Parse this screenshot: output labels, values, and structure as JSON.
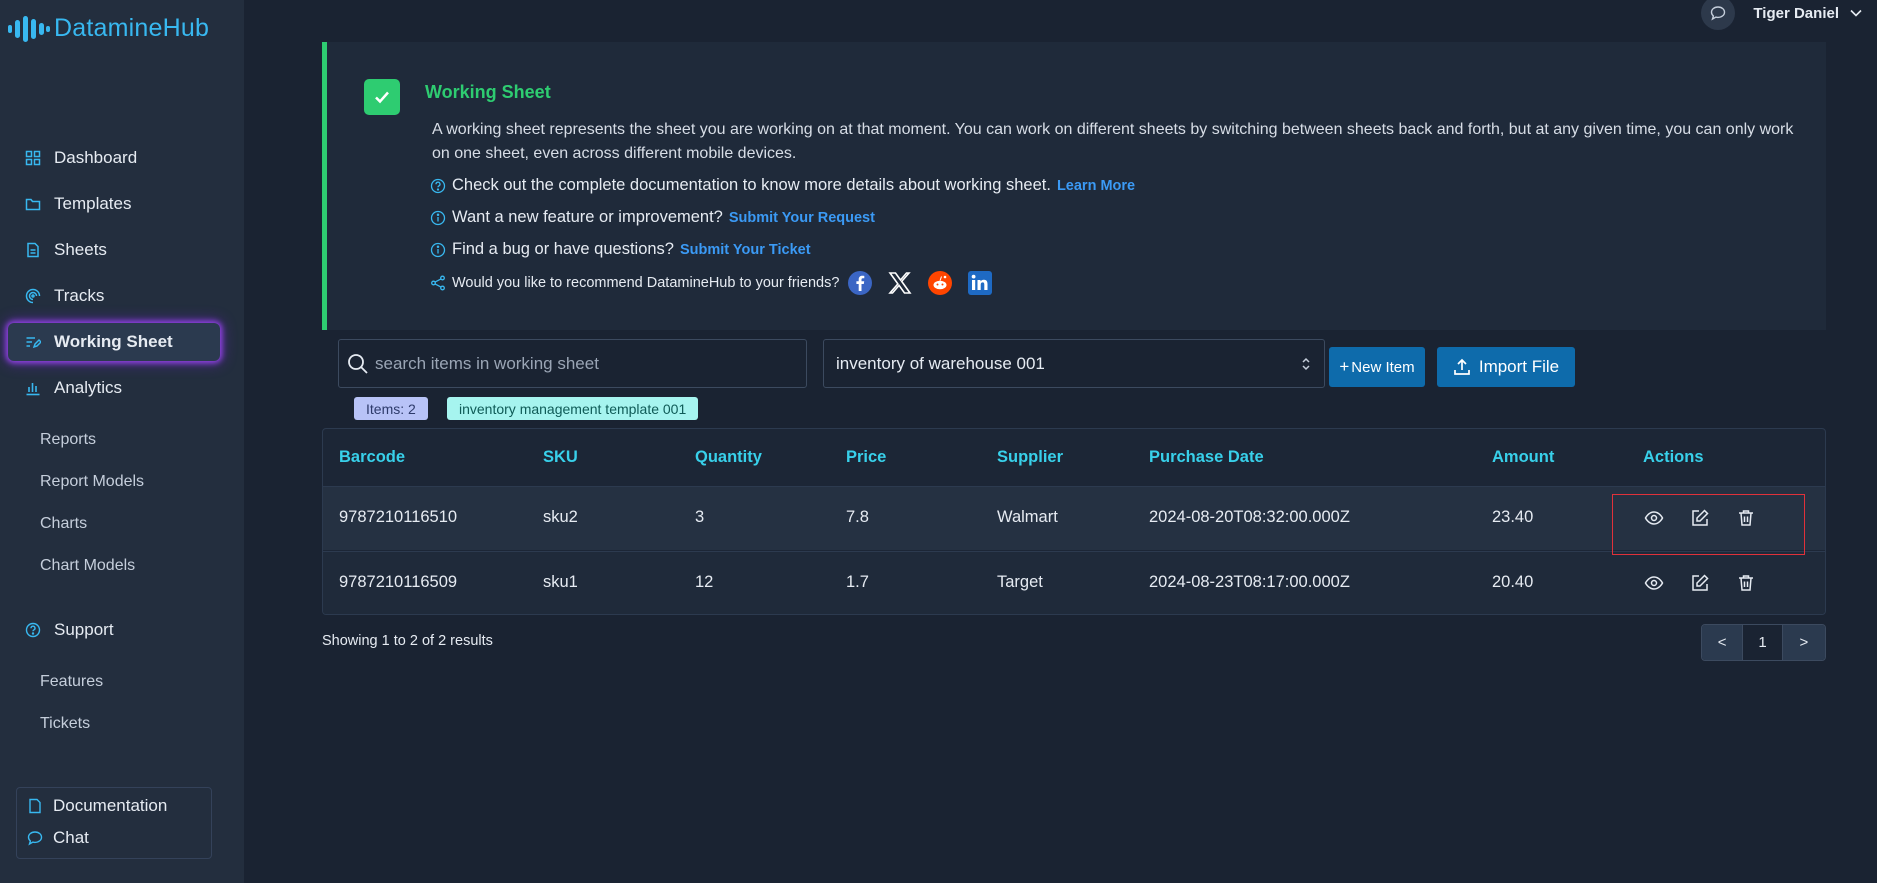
{
  "app": {
    "logo_text": "DatamineHub",
    "accent_color": "#38b8f0"
  },
  "sidebar": {
    "items": [
      {
        "label": "Dashboard",
        "icon": "grid-icon"
      },
      {
        "label": "Templates",
        "icon": "folder-icon"
      },
      {
        "label": "Sheets",
        "icon": "document-icon"
      },
      {
        "label": "Tracks",
        "icon": "tracks-icon"
      },
      {
        "label": "Working Sheet",
        "icon": "edit-list-icon",
        "active": true
      },
      {
        "label": "Analytics",
        "icon": "bar-chart-icon"
      }
    ],
    "analytics_sub": [
      "Reports",
      "Report Models",
      "Charts",
      "Chart Models"
    ],
    "support_label": "Support",
    "support_sub": [
      "Features",
      "Tickets"
    ],
    "help": {
      "documentation": "Documentation",
      "chat": "Chat"
    }
  },
  "header": {
    "user_name": "Tiger Daniel"
  },
  "info": {
    "title": "Working Sheet",
    "description": "A working sheet represents the sheet you are working on at that moment. You can work on different sheets by switching between sheets back and forth, but at any given time, you can only work on one sheet, even across different mobile devices.",
    "docs_text": "Check out the complete documentation to know more details about working sheet.",
    "docs_link": "Learn More",
    "feature_text": "Want a new feature or improvement?",
    "feature_link": "Submit Your Request",
    "bug_text": "Find a bug or have questions?",
    "bug_link": "Submit Your Ticket",
    "share_text": "Would you like to recommend DatamineHub to your friends?",
    "accent_color": "#2ecc71"
  },
  "controls": {
    "search_placeholder": "search items in working sheet",
    "search_value": "",
    "selected_sheet": "inventory of warehouse 001",
    "new_item_label": "New Item",
    "import_label": "Import File"
  },
  "chips": {
    "items_count": "Items: 2",
    "template": "inventory management template 001"
  },
  "table": {
    "headers": [
      "Barcode",
      "SKU",
      "Quantity",
      "Price",
      "Supplier",
      "Purchase Date",
      "Amount",
      "Actions"
    ],
    "rows": [
      {
        "barcode": "9787210116510",
        "sku": "sku2",
        "quantity": "3",
        "price": "7.8",
        "supplier": "Walmart",
        "purchase_date": "2024-08-20T08:32:00.000Z",
        "amount": "23.40"
      },
      {
        "barcode": "9787210116509",
        "sku": "sku1",
        "quantity": "12",
        "price": "1.7",
        "supplier": "Target",
        "purchase_date": "2024-08-23T08:17:00.000Z",
        "amount": "20.40"
      }
    ]
  },
  "pagination": {
    "summary": "Showing 1 to 2 of 2 results",
    "prev": "<",
    "current": "1",
    "next": ">"
  }
}
